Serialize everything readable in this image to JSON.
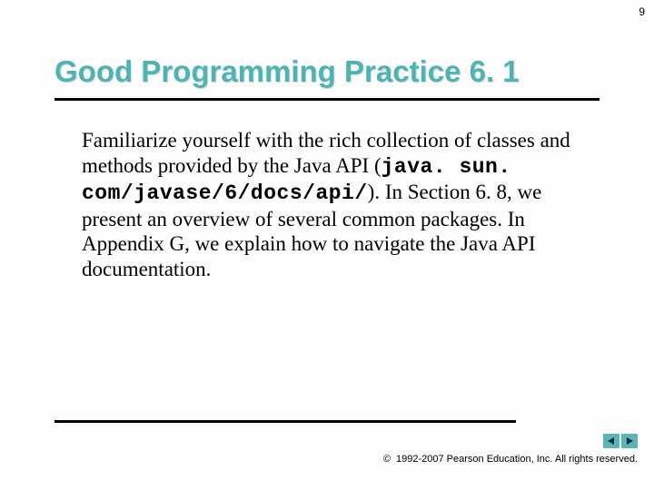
{
  "page_number": "9",
  "title": "Good Programming Practice 6. 1",
  "body": {
    "part1": "Familiarize yourself with the rich collection of classes and methods provided by the Java API (",
    "mono": "java. sun. com/javase/6/docs/api/",
    "part2": "). In Section 6. 8, we present an overview of several common packages. In Appendix G, we explain how to navigate the Java API documentation."
  },
  "footer": {
    "copyright_symbol": "©",
    "text": "1992-2007 Pearson Education, Inc. All rights reserved."
  }
}
